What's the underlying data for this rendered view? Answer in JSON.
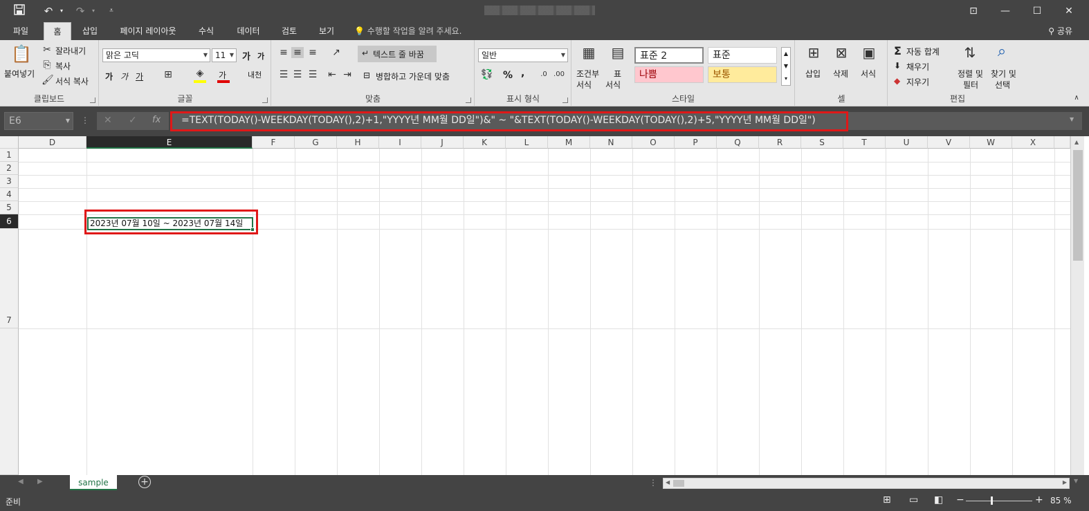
{
  "titlebar": {
    "save_icon": "save-icon",
    "undo_icon": "undo-icon",
    "redo_icon": "redo-icon",
    "window_controls": [
      "ribbon-display-icon",
      "minimize-icon",
      "maximize-icon",
      "close-icon"
    ]
  },
  "tabs": [
    "파일",
    "홈",
    "삽입",
    "페이지 레이아웃",
    "수식",
    "데이터",
    "검토",
    "보기"
  ],
  "active_tab": "홈",
  "tell_me": "수행할 작업을 알려 주세요.",
  "share": "공유",
  "ribbon": {
    "clipboard": {
      "paste": "붙여넣기",
      "cut": "잘라내기",
      "copy": "복사",
      "format_painter": "서식 복사",
      "label": "클립보드"
    },
    "font": {
      "font_name": "맑은 고딕",
      "font_size": "11",
      "bold": "가",
      "italic": "가",
      "underline": "가",
      "grow": "가",
      "shrink": "가",
      "font_color": "가",
      "phonetic": "내천",
      "label": "글꼴"
    },
    "alignment": {
      "wrap_text": "텍스트 줄 바꿈",
      "merge_center": "병합하고 가운데 맞춤",
      "label": "맞춤"
    },
    "number": {
      "format": "일반",
      "percent": "%",
      "comma": ",",
      "label": "표시 형식"
    },
    "styles": {
      "conditional": [
        "조건부",
        "서식"
      ],
      "as_table": [
        "표",
        "서식"
      ],
      "cells": [
        {
          "label": "표준 2",
          "bg": "#ffffff",
          "color": "#000000"
        },
        {
          "label": "표준",
          "bg": "#ffffff",
          "color": "#000000"
        },
        {
          "label": "나쁨",
          "bg": "#ffc7ce",
          "color": "#9c0006"
        },
        {
          "label": "보통",
          "bg": "#ffeb9c",
          "color": "#9c5700"
        }
      ],
      "label": "스타일"
    },
    "cells": {
      "insert": "삽입",
      "delete": "삭제",
      "format": "서식",
      "label": "셀"
    },
    "editing": {
      "autosum": "자동 합계",
      "fill": "채우기",
      "clear": "지우기",
      "sort": [
        "정렬 및",
        "필터"
      ],
      "find": [
        "찾기 및",
        "선택"
      ],
      "label": "편집"
    }
  },
  "formula_bar": {
    "name_box": "E6",
    "cancel": "✕",
    "enter": "✓",
    "fx": "fx",
    "formula": "=TEXT(TODAY()-WEEKDAY(TODAY(),2)+1,\"YYYY년 MM월 DD일\")&\" ~ \"&TEXT(TODAY()-WEEKDAY(TODAY(),2)+5,\"YYYY년 MM월 DD일\")"
  },
  "grid": {
    "columns": [
      "D",
      "E",
      "F",
      "G",
      "H",
      "I",
      "J",
      "K",
      "L",
      "M",
      "N",
      "O",
      "P",
      "Q",
      "R",
      "S",
      "T",
      "U",
      "V",
      "W",
      "X"
    ],
    "rows": [
      "1",
      "2",
      "3",
      "4",
      "5",
      "6",
      "7"
    ],
    "selected_column": "E",
    "selected_row": "6",
    "cell_e6": "2023년 07월 10일 ~ 2023년 07월 14일"
  },
  "sheets": [
    "sample"
  ],
  "status": {
    "mode": "준비",
    "zoom": "85 %"
  }
}
